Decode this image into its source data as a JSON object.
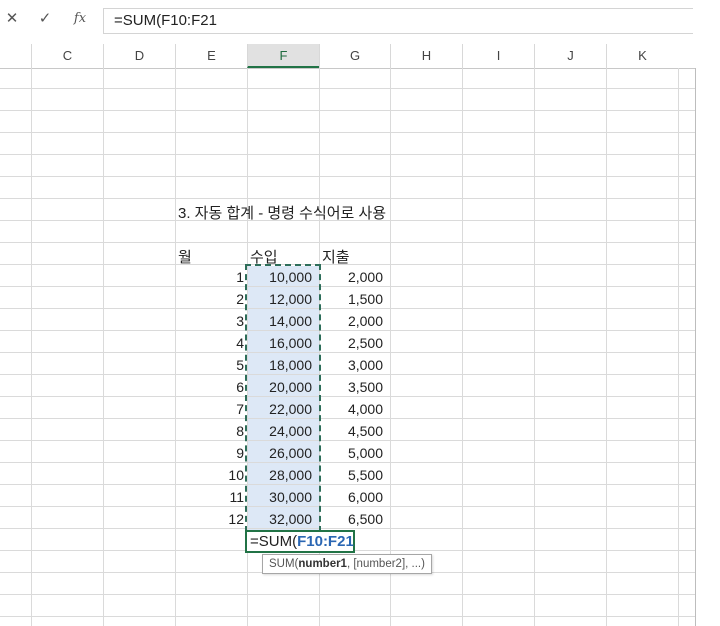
{
  "formula_bar": {
    "cancel_glyph": "✕",
    "enter_glyph": "✓",
    "fx_glyph": "fx",
    "formula": "=SUM(F10:F21"
  },
  "columns": [
    "C",
    "D",
    "E",
    "F",
    "G",
    "H",
    "I",
    "J",
    "K"
  ],
  "selected_column": "F",
  "sheet": {
    "title": "3. 자동 합계 - 명령 수식어로 사용",
    "header_month": "월",
    "header_income": "수입",
    "header_expense": "지출",
    "rows": [
      {
        "month": "1",
        "income": "10,000",
        "expense": "2,000"
      },
      {
        "month": "2",
        "income": "12,000",
        "expense": "1,500"
      },
      {
        "month": "3",
        "income": "14,000",
        "expense": "2,000"
      },
      {
        "month": "4",
        "income": "16,000",
        "expense": "2,500"
      },
      {
        "month": "5",
        "income": "18,000",
        "expense": "3,000"
      },
      {
        "month": "6",
        "income": "20,000",
        "expense": "3,500"
      },
      {
        "month": "7",
        "income": "22,000",
        "expense": "4,000"
      },
      {
        "month": "8",
        "income": "24,000",
        "expense": "4,500"
      },
      {
        "month": "9",
        "income": "26,000",
        "expense": "5,000"
      },
      {
        "month": "10",
        "income": "28,000",
        "expense": "5,500"
      },
      {
        "month": "11",
        "income": "30,000",
        "expense": "6,000"
      },
      {
        "month": "12",
        "income": "32,000",
        "expense": "6,500"
      }
    ]
  },
  "active_cell": {
    "prefix": "=SUM(",
    "range": "F10:F21"
  },
  "tooltip": {
    "fn": "SUM(",
    "arg1": "number1",
    "rest": ", [number2], ...)"
  },
  "colors": {
    "excel_green": "#217346",
    "range_fill": "#dde8f6",
    "ref_blue": "#2a66b3"
  }
}
